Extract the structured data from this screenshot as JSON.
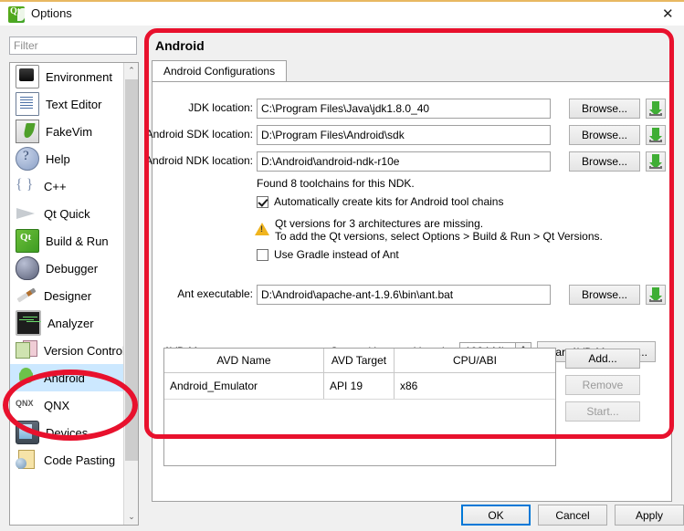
{
  "window": {
    "title": "Options",
    "logo_icon": "qt-logo-icon",
    "close_icon": "✕"
  },
  "sidebar": {
    "filter_placeholder": "Filter",
    "filter_value": "",
    "items": [
      {
        "label": "Environment",
        "icon": "environment-icon",
        "selected": false
      },
      {
        "label": "Text Editor",
        "icon": "text-editor-icon",
        "selected": false
      },
      {
        "label": "FakeVim",
        "icon": "fakevim-icon",
        "selected": false
      },
      {
        "label": "Help",
        "icon": "help-icon",
        "selected": false
      },
      {
        "label": "C++",
        "icon": "cpp-icon",
        "selected": false
      },
      {
        "label": "Qt Quick",
        "icon": "qt-quick-icon",
        "selected": false
      },
      {
        "label": "Build & Run",
        "icon": "build-run-icon",
        "selected": false
      },
      {
        "label": "Debugger",
        "icon": "debugger-icon",
        "selected": false
      },
      {
        "label": "Designer",
        "icon": "designer-icon",
        "selected": false
      },
      {
        "label": "Analyzer",
        "icon": "analyzer-icon",
        "selected": false
      },
      {
        "label": "Version Control",
        "icon": "version-control-icon",
        "selected": false
      },
      {
        "label": "Android",
        "icon": "android-icon",
        "selected": true
      },
      {
        "label": "QNX",
        "icon": "qnx-icon",
        "selected": false
      },
      {
        "label": "Devices",
        "icon": "devices-icon",
        "selected": false
      },
      {
        "label": "Code Pasting",
        "icon": "code-pasting-icon",
        "selected": false
      }
    ],
    "scroll_up_icon": "⌃",
    "scroll_down_icon": "⌄"
  },
  "page": {
    "title": "Android",
    "tab_label": "Android Configurations"
  },
  "form": {
    "jdk": {
      "label": "JDK location:",
      "value": "C:\\Program Files\\Java\\jdk1.8.0_40",
      "browse": "Browse...",
      "download_icon": "download-icon"
    },
    "sdk": {
      "label": "Android SDK location:",
      "value": "D:\\Program Files\\Android\\sdk",
      "browse": "Browse...",
      "download_icon": "download-icon"
    },
    "ndk": {
      "label": "Android NDK location:",
      "value": "D:\\Android\\android-ndk-r10e",
      "browse": "Browse...",
      "download_icon": "download-icon"
    },
    "toolchains_note": "Found 8 toolchains for this NDK.",
    "auto_kits": {
      "label": "Automatically create kits for Android tool chains",
      "checked": true
    },
    "warning": {
      "icon": "warning-icon",
      "line1": "Qt versions for 3 architectures are missing.",
      "line2": "To add the Qt versions, select Options > Build & Run > Qt Versions."
    },
    "gradle": {
      "label": "Use Gradle instead of Ant",
      "checked": false
    },
    "ant": {
      "label": "Ant executable:",
      "value": "D:\\Android\\apache-ant-1.9.6\\bin\\ant.bat",
      "browse": "Browse...",
      "download_icon": "download-icon"
    }
  },
  "avd": {
    "section_label": "AVD Manager",
    "partition_label": "System/data partition size:",
    "partition_value": "1024 Mb",
    "start_manager_button": "Start AVD Manager...",
    "columns": [
      "AVD Name",
      "AVD Target",
      "CPU/ABI"
    ],
    "rows": [
      {
        "name": "Android_Emulator",
        "target": "API 19",
        "abi": "x86"
      }
    ],
    "buttons": {
      "add": "Add...",
      "remove": "Remove",
      "start": "Start..."
    }
  },
  "footer": {
    "ok": "OK",
    "cancel": "Cancel",
    "apply": "Apply"
  },
  "annotations": {
    "color": "#e8112d",
    "rect_target": "android-configurations-panel",
    "ellipse_target": "sidebar-item-android"
  }
}
